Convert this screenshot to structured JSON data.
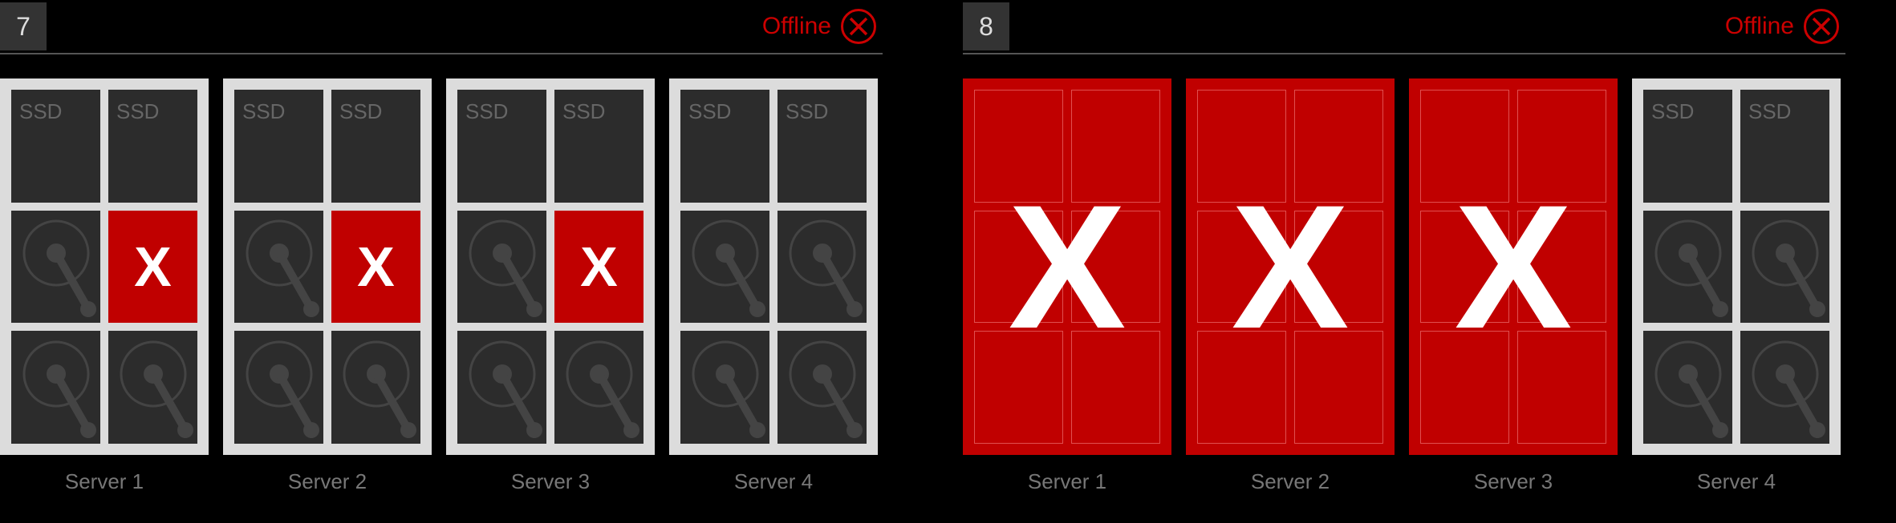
{
  "panels": [
    {
      "number": "7",
      "status_label": "Offline",
      "servers": [
        {
          "label": "Server 1",
          "failed": false,
          "drives": [
            {
              "kind": "ssd",
              "label": "SSD",
              "failed": false
            },
            {
              "kind": "ssd",
              "label": "SSD",
              "failed": false
            },
            {
              "kind": "hdd",
              "failed": false
            },
            {
              "kind": "hdd",
              "failed": true,
              "x": "X"
            },
            {
              "kind": "hdd",
              "failed": false
            },
            {
              "kind": "hdd",
              "failed": false
            }
          ]
        },
        {
          "label": "Server 2",
          "failed": false,
          "drives": [
            {
              "kind": "ssd",
              "label": "SSD",
              "failed": false
            },
            {
              "kind": "ssd",
              "label": "SSD",
              "failed": false
            },
            {
              "kind": "hdd",
              "failed": false
            },
            {
              "kind": "hdd",
              "failed": true,
              "x": "X"
            },
            {
              "kind": "hdd",
              "failed": false
            },
            {
              "kind": "hdd",
              "failed": false
            }
          ]
        },
        {
          "label": "Server 3",
          "failed": false,
          "drives": [
            {
              "kind": "ssd",
              "label": "SSD",
              "failed": false
            },
            {
              "kind": "ssd",
              "label": "SSD",
              "failed": false
            },
            {
              "kind": "hdd",
              "failed": false
            },
            {
              "kind": "hdd",
              "failed": true,
              "x": "X"
            },
            {
              "kind": "hdd",
              "failed": false
            },
            {
              "kind": "hdd",
              "failed": false
            }
          ]
        },
        {
          "label": "Server 4",
          "failed": false,
          "drives": [
            {
              "kind": "ssd",
              "label": "SSD",
              "failed": false
            },
            {
              "kind": "ssd",
              "label": "SSD",
              "failed": false
            },
            {
              "kind": "hdd",
              "failed": false
            },
            {
              "kind": "hdd",
              "failed": false
            },
            {
              "kind": "hdd",
              "failed": false
            },
            {
              "kind": "hdd",
              "failed": false
            }
          ]
        }
      ]
    },
    {
      "number": "8",
      "status_label": "Offline",
      "servers": [
        {
          "label": "Server 1",
          "failed": true,
          "x": "X"
        },
        {
          "label": "Server 2",
          "failed": true,
          "x": "X"
        },
        {
          "label": "Server 3",
          "failed": true,
          "x": "X"
        },
        {
          "label": "Server 4",
          "failed": false,
          "drives": [
            {
              "kind": "ssd",
              "label": "SSD",
              "failed": false
            },
            {
              "kind": "ssd",
              "label": "SSD",
              "failed": false
            },
            {
              "kind": "hdd",
              "failed": false
            },
            {
              "kind": "hdd",
              "failed": false
            },
            {
              "kind": "hdd",
              "failed": false
            },
            {
              "kind": "hdd",
              "failed": false
            }
          ]
        }
      ]
    }
  ]
}
